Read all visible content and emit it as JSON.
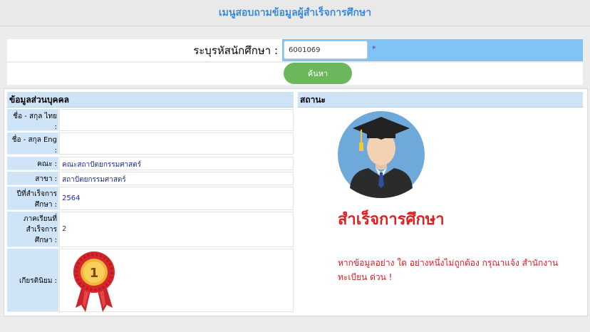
{
  "header": {
    "title": "เมนูสอบถามข้อมูลผู้สำเร็จการศึกษา"
  },
  "search": {
    "label": "ระบุรหัสนักศึกษา :",
    "value": "6001069",
    "required_mark": "*",
    "button_label": "ค้นหา"
  },
  "personal": {
    "heading": "ข้อมูลส่วนบุคคล",
    "rows": [
      {
        "label": "ชื่อ - สกุล ไทย :",
        "value": ""
      },
      {
        "label": "ชื่อ - สกุล Eng :",
        "value": ""
      },
      {
        "label": "คณะ :",
        "value": "คณะสถาปัตยกรรมศาสตร์"
      },
      {
        "label": "สาขา :",
        "value": "สถาปัตยกรรมศาสตร์"
      },
      {
        "label": "ปีที่สำเร็จการศึกษา :",
        "value": "2564"
      },
      {
        "label": "ภาคเรียนที่สำเร็จการศึกษา :",
        "value": "2"
      },
      {
        "label": "เกียรตินิยม :",
        "value": ""
      }
    ],
    "honor_medal_number": "1"
  },
  "status": {
    "heading": "สถานะ",
    "result": "สำเร็จการศึกษา",
    "note": "หากข้อมูลอย่าง ใด อย่างหนึ่งไม่ถูกต้อง กรุณาแจ้ง สำนักงานทะเบียน ด่วน !"
  },
  "colors": {
    "title_text": "#3b8ad8",
    "input_row_bg": "#7ec4f7",
    "search_button": "#6cb75c",
    "label_bg": "#d0e4f8",
    "status_text": "#e02020"
  }
}
